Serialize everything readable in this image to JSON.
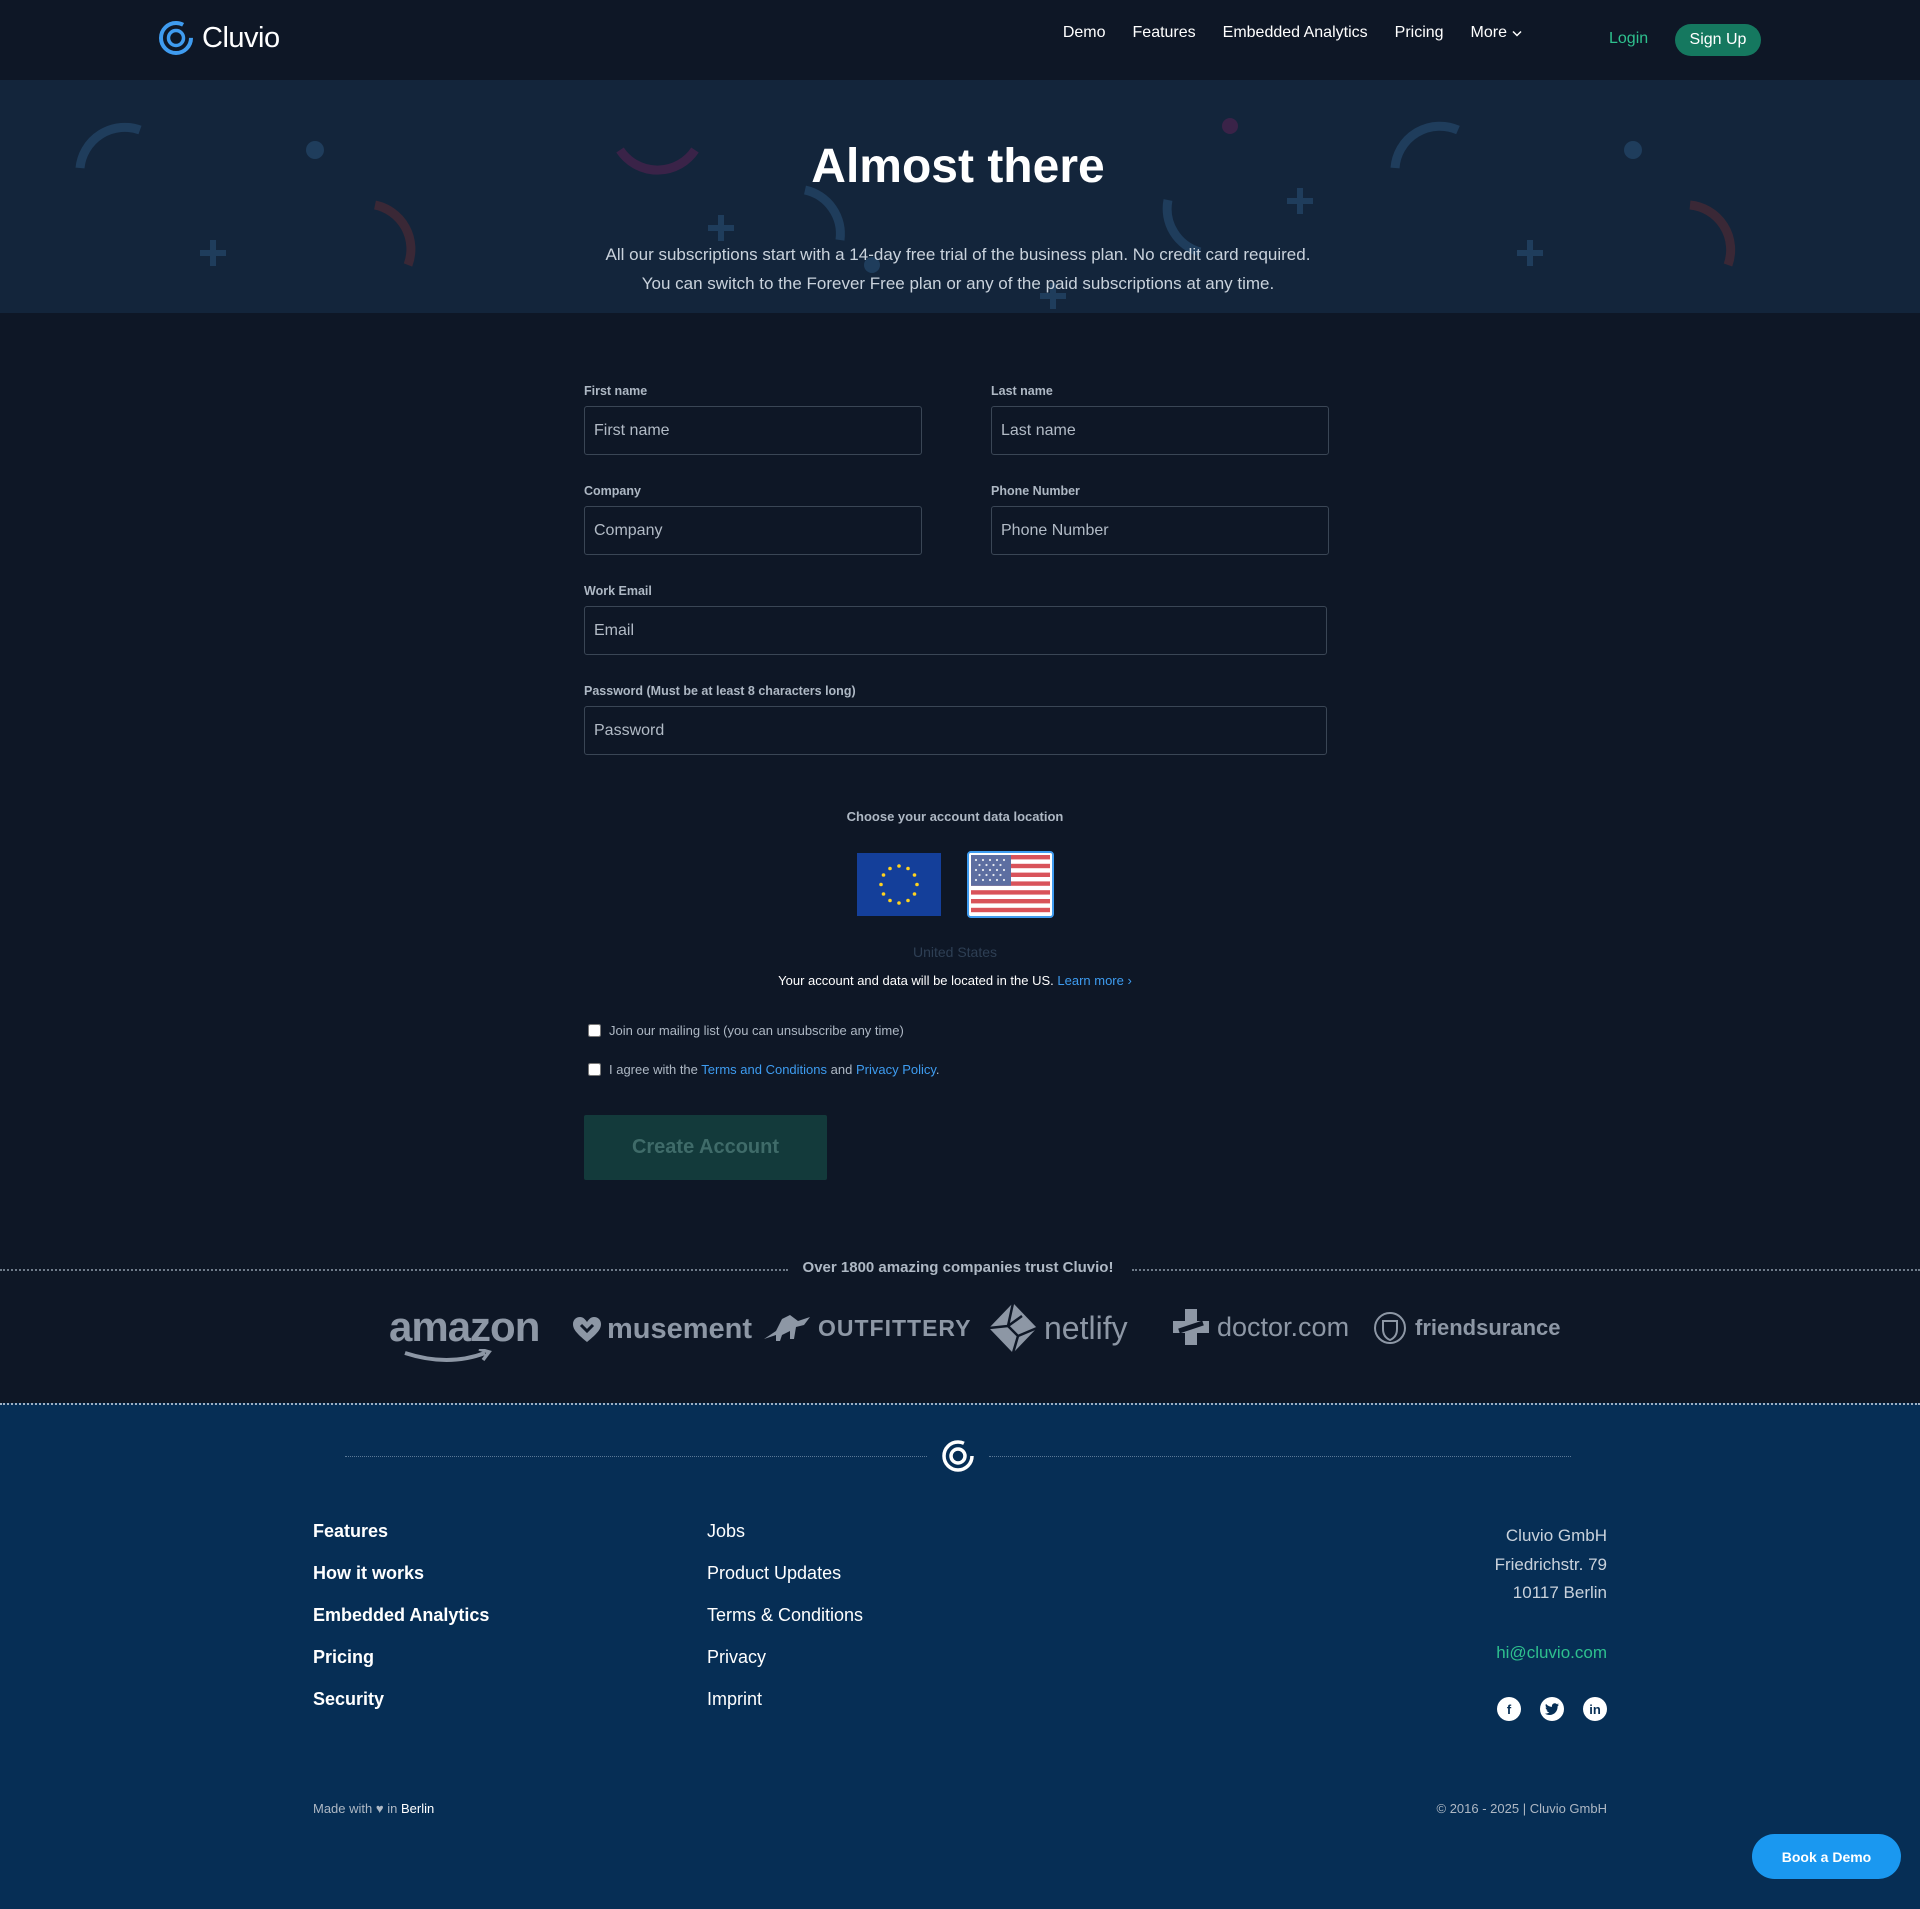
{
  "header": {
    "brand": "Cluvio",
    "nav": [
      "Demo",
      "Features",
      "Embedded Analytics",
      "Pricing"
    ],
    "more_label": "More",
    "login_label": "Login",
    "signup_label": "Sign Up"
  },
  "hero": {
    "title": "Almost there",
    "line1": "All our subscriptions start with a 14-day free trial of the business plan. No credit card required.",
    "line2": "You can switch to the Forever Free plan or any of the paid subscriptions at any time."
  },
  "form": {
    "first_name": {
      "label": "First name",
      "placeholder": "First name"
    },
    "last_name": {
      "label": "Last name",
      "placeholder": "Last name"
    },
    "company": {
      "label": "Company",
      "placeholder": "Company"
    },
    "phone": {
      "label": "Phone Number",
      "placeholder": "Phone Number"
    },
    "email": {
      "label": "Work Email",
      "placeholder": "Email"
    },
    "password": {
      "label": "Password (Must be at least 8 characters long)",
      "placeholder": "Password"
    },
    "location_title": "Choose your account data location",
    "location_selected": "United States",
    "location_note": "Your account and data will be located in the US.",
    "learn_more": "Learn more ›",
    "mailing_label": "Join our mailing list (you can unsubscribe any time)",
    "agree_prefix": "I agree with the",
    "terms_link": "Terms and Conditions",
    "agree_and": "and",
    "privacy_link": "Privacy Policy",
    "agree_suffix": ".",
    "submit_label": "Create Account"
  },
  "trust": {
    "text": "Over 1800 amazing companies trust Cluvio!",
    "brands": [
      "amazon",
      "musement",
      "OUTFITTERY",
      "netlify",
      "doctor.com",
      "friendsurance"
    ]
  },
  "footer": {
    "col1": [
      "Features",
      "How it works",
      "Embedded Analytics",
      "Pricing",
      "Security"
    ],
    "col2": [
      "Jobs",
      "Product Updates",
      "Terms & Conditions",
      "Privacy",
      "Imprint"
    ],
    "address": [
      "Cluvio GmbH",
      "Friedrichstr. 79",
      "10117 Berlin"
    ],
    "email": "hi@cluvio.com",
    "social": [
      "facebook-icon",
      "twitter-icon",
      "linkedin-icon"
    ],
    "made_prefix": "Made with",
    "made_heart": "♥",
    "made_in": "in",
    "made_city": "Berlin",
    "copyright": "© 2016 - 2025 | Cluvio GmbH"
  },
  "book_demo_label": "Book a Demo",
  "colors": {
    "background": "#0e1726",
    "hero": "#13253b",
    "footer": "#062e55",
    "accent_green": "#2ec08e",
    "link_blue": "#3e9cf0",
    "signup_green": "#15785f"
  }
}
